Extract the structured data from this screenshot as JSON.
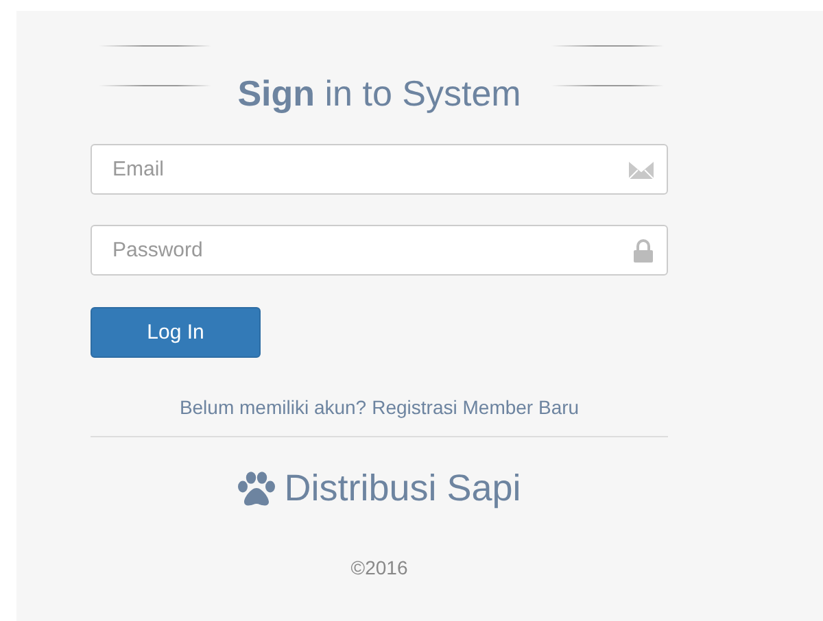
{
  "heading": "**Sign** in to System",
  "fields": [
    {
      "placeholder": "Email",
      "kind": "email"
    },
    {
      "placeholder": "Password",
      "kind": "password"
    }
  ],
  "login_button": "Log In",
  "register": {
    "prompt": "Belum memiliki akun?",
    "link": "Registrasi Member Baru"
  },
  "brand": "Distribusi Sapi",
  "copyright": "©2016"
}
